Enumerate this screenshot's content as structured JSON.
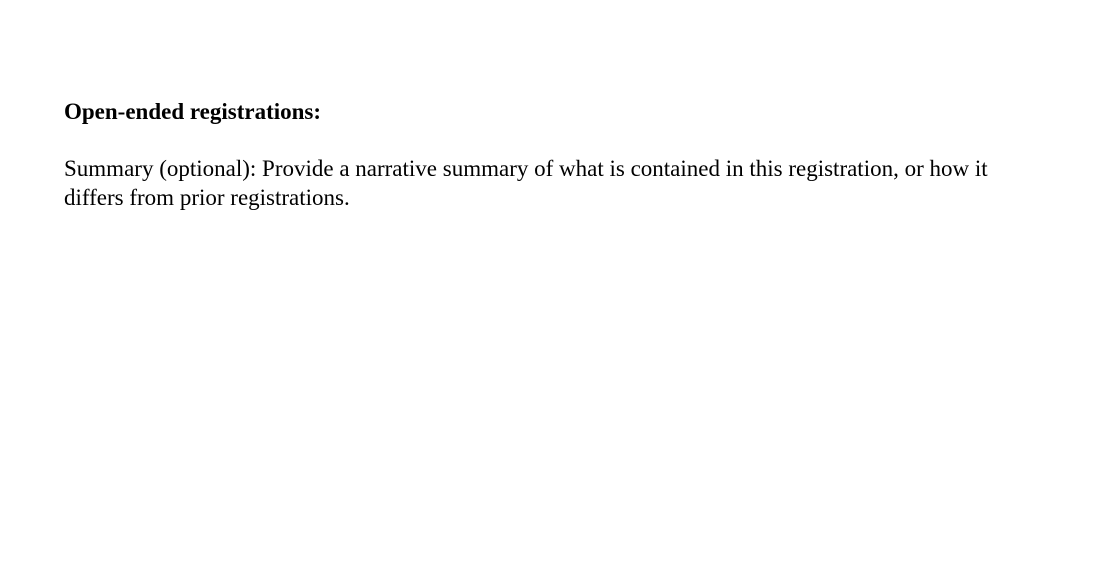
{
  "document": {
    "heading": "Open-ended registrations:",
    "paragraph": "Summary (optional): Provide a narrative summary of what is contained in this registration, or how it differs from prior registrations."
  }
}
